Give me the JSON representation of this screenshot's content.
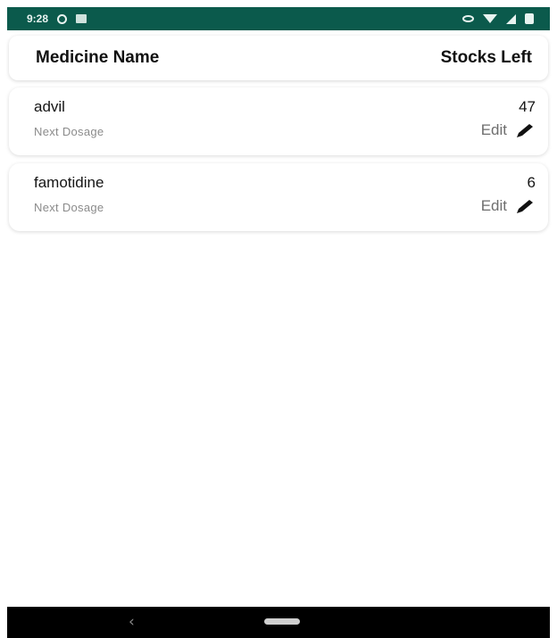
{
  "status_bar": {
    "time": "9:28",
    "left_icons": [
      "sync-icon",
      "image-icon"
    ],
    "right_icons": [
      "eye-icon",
      "wifi-icon",
      "signal-icon",
      "battery-icon"
    ],
    "color": "#0b5a4c"
  },
  "header": {
    "name_column": "Medicine Name",
    "stock_column": "Stocks Left"
  },
  "medicines": [
    {
      "name": "advil",
      "stock": "47",
      "subtitle": "Next Dosage",
      "edit_label": "Edit"
    },
    {
      "name": "famotidine",
      "stock": "6",
      "subtitle": "Next Dosage",
      "edit_label": "Edit"
    }
  ],
  "nav_bar": {
    "back_symbol": "‹",
    "icons": [
      "back-icon",
      "home-pill-icon"
    ]
  }
}
